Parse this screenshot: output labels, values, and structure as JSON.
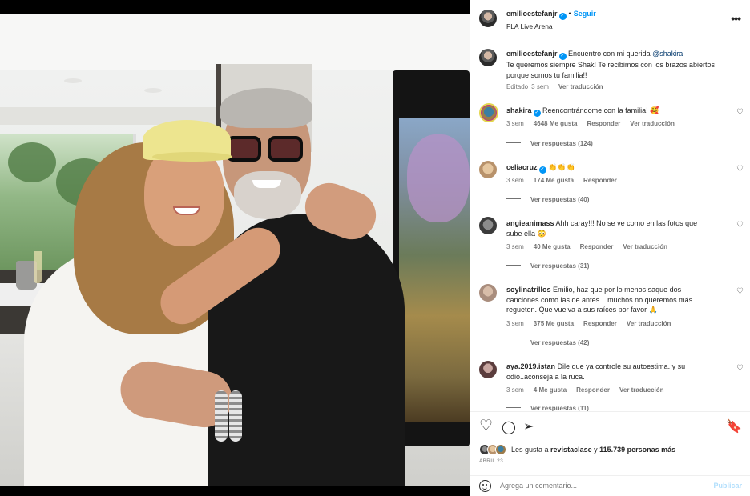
{
  "post": {
    "author": "emilioestefanjr",
    "follow_label": "Seguir",
    "separator": "•",
    "location": "FLA Live Arena",
    "more_label": "•••"
  },
  "caption": {
    "author": "emilioestefanjr",
    "text_before": "Encuentro con mi querida ",
    "mention": "@shakira",
    "text_after": "Te queremos siempre Shak! Te recibimos con los brazos abiertos porque somos tu familia!!",
    "edited": "Editado",
    "time": "3 sem",
    "translate": "Ver traducción"
  },
  "comments": [
    {
      "username": "shakira",
      "verified": true,
      "text": "Reencontrándome con la familia! 🥰",
      "time": "3 sem",
      "likes": "4648 Me gusta",
      "reply": "Responder",
      "translate": "Ver traducción",
      "replies": "Ver respuestas (124)"
    },
    {
      "username": "celiacruz",
      "verified": true,
      "text": "👏👏👏",
      "time": "3 sem",
      "likes": "174 Me gusta",
      "reply": "Responder",
      "translate": "",
      "replies": "Ver respuestas (40)"
    },
    {
      "username": "angieanimass",
      "verified": false,
      "text": "Ahh caray!!! No se ve como en las fotos que sube ella 😳",
      "time": "3 sem",
      "likes": "40 Me gusta",
      "reply": "Responder",
      "translate": "Ver traducción",
      "replies": "Ver respuestas (31)"
    },
    {
      "username": "soylinatrillos",
      "verified": false,
      "text": "Emilio, haz que por lo menos saque dos canciones como las de antes... muchos no queremos más regueton. Que vuelva a sus raíces por favor 🙏",
      "time": "3 sem",
      "likes": "375 Me gusta",
      "reply": "Responder",
      "translate": "Ver traducción",
      "replies": "Ver respuestas (42)"
    },
    {
      "username": "aya.2019.istan",
      "verified": false,
      "text": "Dile que ya controle su autoestima. y su odio..aconseja a la ruca.",
      "time": "3 sem",
      "likes": "4 Me gusta",
      "reply": "Responder",
      "translate": "Ver traducción",
      "replies": "Ver respuestas (11)"
    }
  ],
  "actions": {
    "heart": "♡",
    "comment": "◯",
    "share": "➢",
    "save": "🔖"
  },
  "likes": {
    "prefix": "Les gusta a ",
    "user": "revistaclase",
    "middle": " y ",
    "count": "115.739 personas más"
  },
  "date": "ABRIL 23",
  "add_comment": {
    "placeholder": "Agrega un comentario...",
    "publish": "Publicar"
  },
  "icons": {
    "verified": "✓",
    "comment_heart": "♡"
  },
  "colors": {
    "accent": "#0095f6",
    "mention": "#00376b",
    "muted": "#737373",
    "publish_disabled": "#b2dffc"
  }
}
